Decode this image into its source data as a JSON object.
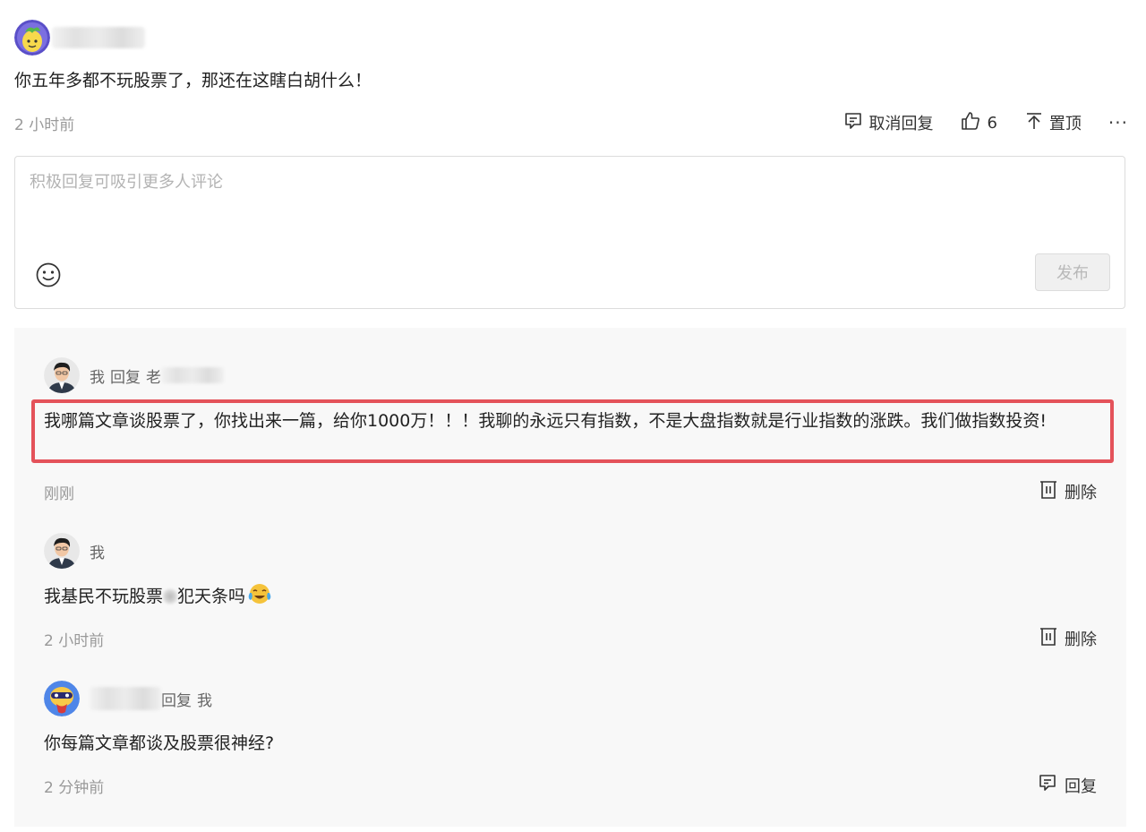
{
  "comment": {
    "text": "你五年多都不玩股票了，那还在这瞎白胡什么！",
    "time": "2 小时前",
    "actions": {
      "cancel_reply": "取消回复",
      "like_count": "6",
      "pin": "置顶",
      "more": "···"
    }
  },
  "editor": {
    "placeholder": "积极回复可吸引更多人评论",
    "publish_label": "发布"
  },
  "replies": [
    {
      "author": "我",
      "reply_word": "回复",
      "reply_to_visible": "老",
      "text": "我哪篇文章谈股票了，你找出来一篇，给你1000万！！！我聊的永远只有指数，不是大盘指数就是行业指数的涨跌。我们做指数投资!",
      "time": "刚刚",
      "action": "删除",
      "highlighted": true
    },
    {
      "author": "我",
      "text_before": "我基民不玩股票",
      "text_after": "犯天条吗",
      "emoji": "crying-laughing-face",
      "time": "2 小时前",
      "action": "删除"
    },
    {
      "reply_word_tail": "回复",
      "reply_to": "我",
      "text": "你每篇文章都谈及股票很神经?",
      "time": "2 分钟前",
      "action": "回复"
    }
  ],
  "colors": {
    "highlight_border": "#e4525a",
    "thread_bg": "#f8f8f8",
    "muted_text": "#999999"
  }
}
